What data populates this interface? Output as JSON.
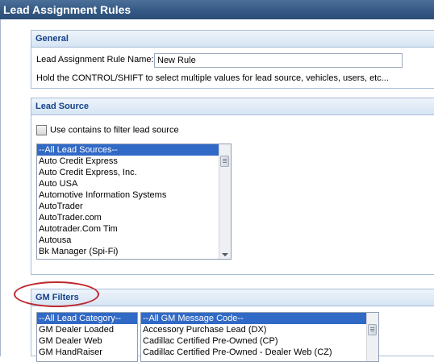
{
  "window": {
    "title": "Lead Assignment Rules"
  },
  "general": {
    "heading": "General",
    "name_label": "Lead Assignment Rule Name:",
    "name_value": "New Rule",
    "hint": "Hold the CONTROL/SHIFT to select multiple values for lead source, vehicles, users, etc..."
  },
  "lead_source": {
    "heading": "Lead Source",
    "contains_label": "Use contains to filter lead source",
    "items": [
      "--All Lead Sources--",
      "Auto Credit Express",
      "Auto Credit Express, Inc.",
      "Auto USA",
      "Automotive Information Systems",
      "AutoTrader",
      "AutoTrader.com",
      "Autotrader.Com Tim",
      "Autousa",
      "Bk Manager (Spi-Fi)"
    ]
  },
  "gm_filters": {
    "heading": "GM Filters",
    "categories": [
      "--All Lead Category--",
      "GM Dealer Loaded",
      "GM Dealer Web",
      "GM HandRaiser"
    ],
    "message_codes": [
      "--All GM Message Code--",
      "Accessory Purchase Lead (DX)",
      "Cadillac Certified Pre-Owned (CP)",
      "Cadillac Certified Pre-Owned - Dealer Web (CZ)"
    ]
  },
  "colors": {
    "title_bar": "#355a85",
    "panel_heading_text": "#15428b",
    "selection": "#3169c6",
    "annotation": "#c0272d"
  }
}
